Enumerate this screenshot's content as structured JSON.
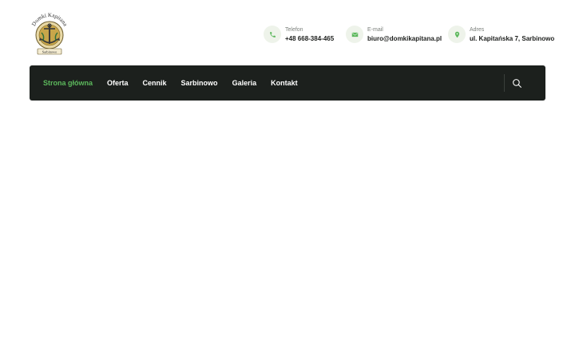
{
  "brand": {
    "logo_text_top": "Domki Kapitana",
    "logo_text_bottom": "Sarbinowo"
  },
  "contacts": {
    "phone": {
      "label": "Telefon",
      "value": "+48 668-384-465",
      "icon": "phone-icon"
    },
    "email": {
      "label": "E-mail",
      "value": "biuro@domkikapitana.pl",
      "icon": "envelope-icon"
    },
    "address": {
      "label": "Adres",
      "value": "ul. Kapitańska 7, Sarbinowo",
      "icon": "map-pin-icon"
    }
  },
  "nav": {
    "items": [
      {
        "label": "Strona główna",
        "active": true
      },
      {
        "label": "Oferta",
        "active": false
      },
      {
        "label": "Cennik",
        "active": false
      },
      {
        "label": "Sarbinowo",
        "active": false
      },
      {
        "label": "Galeria",
        "active": false
      },
      {
        "label": "Kontakt",
        "active": false
      }
    ],
    "search_icon": "search-icon"
  },
  "colors": {
    "accent": "#5cb85c",
    "navbar_bg": "#1c201d",
    "icon_circle_bg": "#eef3ea",
    "text_dark": "#1c1e1c"
  }
}
